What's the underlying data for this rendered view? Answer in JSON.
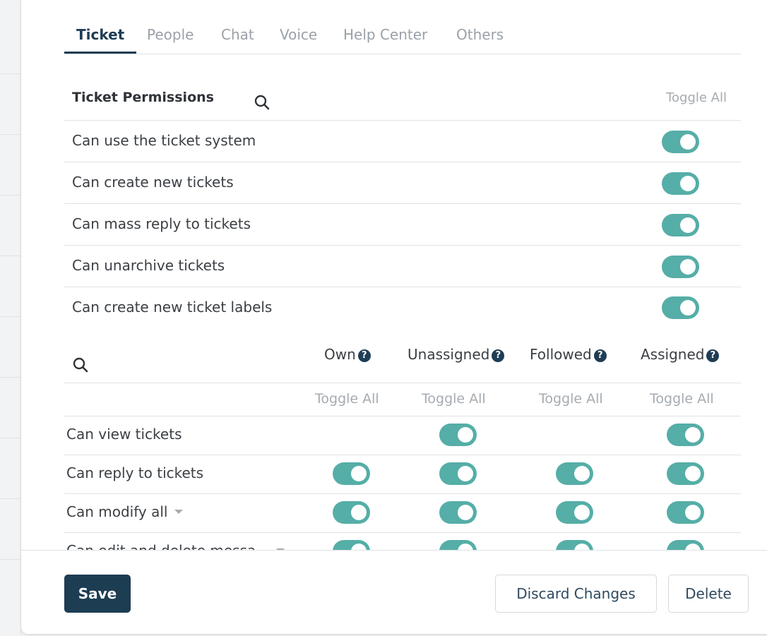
{
  "tabs": [
    {
      "label": "Ticket",
      "active": true
    },
    {
      "label": "People"
    },
    {
      "label": "Chat"
    },
    {
      "label": "Voice"
    },
    {
      "label": "Help Center"
    },
    {
      "label": "Others"
    }
  ],
  "ticket_permissions": {
    "title": "Ticket Permissions",
    "toggle_all": "Toggle All",
    "rows": [
      {
        "label": "Can use the ticket system",
        "enabled": true
      },
      {
        "label": "Can create new tickets",
        "enabled": true
      },
      {
        "label": "Can mass reply to tickets",
        "enabled": true
      },
      {
        "label": "Can unarchive tickets",
        "enabled": true
      },
      {
        "label": "Can create new ticket labels",
        "enabled": true
      }
    ]
  },
  "matrix": {
    "columns": [
      "Own",
      "Unassigned",
      "Followed",
      "Assigned"
    ],
    "help_glyph": "?",
    "toggle_all": [
      "Toggle All",
      "Toggle All",
      "Toggle All",
      "Toggle All"
    ],
    "rows": [
      {
        "label": "Can view tickets",
        "toggles": [
          false,
          true,
          false,
          true
        ]
      },
      {
        "label": "Can reply to tickets",
        "toggles": [
          true,
          true,
          true,
          true
        ]
      },
      {
        "label": "Can modify all",
        "toggles": [
          true,
          true,
          true,
          true
        ],
        "dropdown": true
      },
      {
        "label": "Can edit and delete messa...",
        "toggles": [
          true,
          true,
          true,
          true
        ],
        "dropdown": true
      }
    ]
  },
  "footer": {
    "save": "Save",
    "discard": "Discard Changes",
    "delete": "Delete"
  },
  "colors": {
    "toggle_on": "#55aea7",
    "primary": "#1d3d53"
  }
}
